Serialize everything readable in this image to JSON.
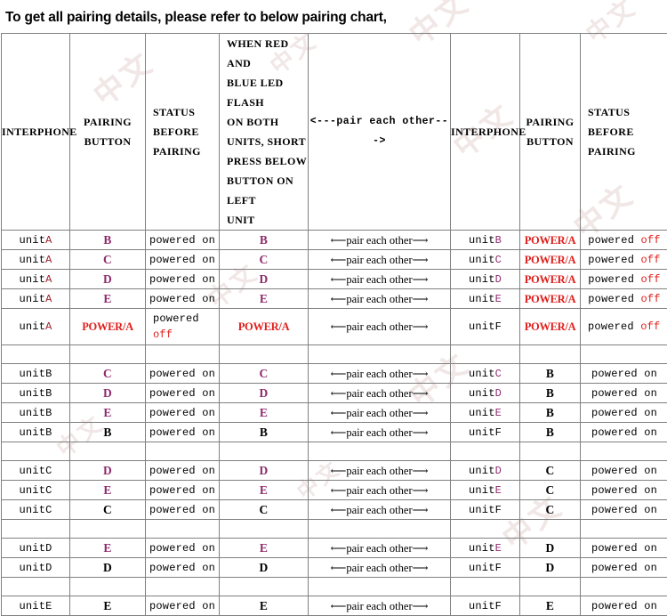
{
  "headline": "To get all pairing details, please refer to below pairing chart,",
  "colors": {
    "red": "#e01f1c",
    "dark_red": "#9e1d2b",
    "purple": "#8d2a6b",
    "black": "#000000",
    "border": "#808080"
  },
  "table": {
    "headers": [
      {
        "lines": [
          "INTERPHONE"
        ],
        "align": "center"
      },
      {
        "lines": [
          "PAIRING",
          "BUTTON"
        ],
        "align": "center"
      },
      {
        "lines": [
          "STATUS",
          "BEFORE",
          "PAIRING"
        ],
        "align": "left"
      },
      {
        "lines": [
          "WHEN RED AND",
          "BLUE LED FLASH",
          "ON BOTH",
          "UNITS, SHORT",
          "PRESS BELOW",
          "BUTTON ON LEFT",
          "UNIT"
        ],
        "align": "left"
      },
      {
        "lines": [
          "<---pair  each other--->"
        ],
        "align": "center"
      },
      {
        "lines": [
          "INTERPHONE"
        ],
        "align": "center"
      },
      {
        "lines": [
          "PAIRING",
          "BUTTON"
        ],
        "align": "center"
      },
      {
        "lines": [
          "STATUS",
          "BEFORE PAIRING"
        ],
        "align": "left"
      }
    ],
    "arrow_cell_text": "⟵pair each other⟶",
    "groups": [
      {
        "name": "group-unitA",
        "rows": [
          {
            "left_unit_base": "unit",
            "left_unit_suffix": "A",
            "left_unit_suffix_color": "darkred",
            "left_button": "B",
            "left_button_color": "purple",
            "left_status_line1": "powered on",
            "left_status_line2": "",
            "left_status_color2": "",
            "press_button": "B",
            "press_button_color": "purple",
            "right_unit_base": "unit",
            "right_unit_suffix": "B",
            "right_unit_suffix_color": "purple",
            "right_button": "POWER/A",
            "right_button_color": "red",
            "right_status_prefix": "powered ",
            "right_status_state": "off",
            "right_status_color": "red",
            "tall": false
          },
          {
            "left_unit_base": "unit",
            "left_unit_suffix": "A",
            "left_unit_suffix_color": "darkred",
            "left_button": "C",
            "left_button_color": "purple",
            "left_status_line1": "powered on",
            "left_status_line2": "",
            "left_status_color2": "",
            "press_button": "C",
            "press_button_color": "purple",
            "right_unit_base": "unit",
            "right_unit_suffix": "C",
            "right_unit_suffix_color": "purple",
            "right_button": "POWER/A",
            "right_button_color": "red",
            "right_status_prefix": "powered ",
            "right_status_state": "off",
            "right_status_color": "red",
            "tall": false
          },
          {
            "left_unit_base": "unit",
            "left_unit_suffix": "A",
            "left_unit_suffix_color": "darkred",
            "left_button": "D",
            "left_button_color": "purple",
            "left_status_line1": "powered on",
            "left_status_line2": "",
            "left_status_color2": "",
            "press_button": "D",
            "press_button_color": "purple",
            "right_unit_base": "unit",
            "right_unit_suffix": "D",
            "right_unit_suffix_color": "purple",
            "right_button": "POWER/A",
            "right_button_color": "red",
            "right_status_prefix": "powered ",
            "right_status_state": "off",
            "right_status_color": "red",
            "tall": false
          },
          {
            "left_unit_base": "unit",
            "left_unit_suffix": "A",
            "left_unit_suffix_color": "darkred",
            "left_button": "E",
            "left_button_color": "purple",
            "left_status_line1": "powered on",
            "left_status_line2": "",
            "left_status_color2": "",
            "press_button": "E",
            "press_button_color": "purple",
            "right_unit_base": "unit",
            "right_unit_suffix": "E",
            "right_unit_suffix_color": "purple",
            "right_button": "POWER/A",
            "right_button_color": "red",
            "right_status_prefix": "powered ",
            "right_status_state": "off",
            "right_status_color": "red",
            "tall": false
          },
          {
            "left_unit_base": "unit",
            "left_unit_suffix": "A",
            "left_unit_suffix_color": "darkred",
            "left_button": "POWER/A",
            "left_button_color": "red",
            "left_status_line1": "powered",
            "left_status_line2": "off",
            "left_status_color2": "red",
            "press_button": "POWER/A",
            "press_button_color": "red",
            "right_unit_base": "unit",
            "right_unit_suffix": "F",
            "right_unit_suffix_color": "black",
            "right_button": "POWER/A",
            "right_button_color": "red",
            "right_status_prefix": "powered ",
            "right_status_state": "off",
            "right_status_color": "red",
            "tall": true
          }
        ]
      },
      {
        "name": "group-unitB",
        "rows": [
          {
            "left_unit_base": "unit",
            "left_unit_suffix": "B",
            "left_unit_suffix_color": "black",
            "left_button": "C",
            "left_button_color": "purple",
            "left_status_line1": "powered on",
            "left_status_line2": "",
            "left_status_color2": "",
            "press_button": "C",
            "press_button_color": "purple",
            "right_unit_base": "unit",
            "right_unit_suffix": "C",
            "right_unit_suffix_color": "purple",
            "right_button": "B",
            "right_button_color": "black",
            "right_status_prefix": "powered ",
            "right_status_state": "on",
            "right_status_color": "black",
            "tall": false
          },
          {
            "left_unit_base": "unit",
            "left_unit_suffix": "B",
            "left_unit_suffix_color": "black",
            "left_button": "D",
            "left_button_color": "purple",
            "left_status_line1": "powered on",
            "left_status_line2": "",
            "left_status_color2": "",
            "press_button": "D",
            "press_button_color": "purple",
            "right_unit_base": "unit",
            "right_unit_suffix": "D",
            "right_unit_suffix_color": "purple",
            "right_button": "B",
            "right_button_color": "black",
            "right_status_prefix": "powered ",
            "right_status_state": "on",
            "right_status_color": "black",
            "tall": false
          },
          {
            "left_unit_base": "unit",
            "left_unit_suffix": "B",
            "left_unit_suffix_color": "black",
            "left_button": "E",
            "left_button_color": "purple",
            "left_status_line1": "powered on",
            "left_status_line2": "",
            "left_status_color2": "",
            "press_button": "E",
            "press_button_color": "purple",
            "right_unit_base": "unit",
            "right_unit_suffix": "E",
            "right_unit_suffix_color": "purple",
            "right_button": "B",
            "right_button_color": "black",
            "right_status_prefix": "powered ",
            "right_status_state": "on",
            "right_status_color": "black",
            "tall": false
          },
          {
            "left_unit_base": "unit",
            "left_unit_suffix": "B",
            "left_unit_suffix_color": "black",
            "left_button": "B",
            "left_button_color": "black",
            "left_status_line1": "powered on",
            "left_status_line2": "",
            "left_status_color2": "",
            "press_button": "B",
            "press_button_color": "black",
            "right_unit_base": "unit",
            "right_unit_suffix": "F",
            "right_unit_suffix_color": "black",
            "right_button": "B",
            "right_button_color": "black",
            "right_status_prefix": "powered ",
            "right_status_state": "on",
            "right_status_color": "black",
            "tall": false
          }
        ]
      },
      {
        "name": "group-unitC",
        "rows": [
          {
            "left_unit_base": "unit",
            "left_unit_suffix": "C",
            "left_unit_suffix_color": "black",
            "left_button": "D",
            "left_button_color": "purple",
            "left_status_line1": "powered on",
            "left_status_line2": "",
            "left_status_color2": "",
            "press_button": "D",
            "press_button_color": "purple",
            "right_unit_base": "unit",
            "right_unit_suffix": "D",
            "right_unit_suffix_color": "purple",
            "right_button": "C",
            "right_button_color": "black",
            "right_status_prefix": "powered ",
            "right_status_state": "on",
            "right_status_color": "black",
            "tall": false
          },
          {
            "left_unit_base": "unit",
            "left_unit_suffix": "C",
            "left_unit_suffix_color": "black",
            "left_button": "E",
            "left_button_color": "purple",
            "left_status_line1": "powered on",
            "left_status_line2": "",
            "left_status_color2": "",
            "press_button": "E",
            "press_button_color": "purple",
            "right_unit_base": "unit",
            "right_unit_suffix": "E",
            "right_unit_suffix_color": "purple",
            "right_button": "C",
            "right_button_color": "black",
            "right_status_prefix": "powered ",
            "right_status_state": "on",
            "right_status_color": "black",
            "tall": false
          },
          {
            "left_unit_base": "unit",
            "left_unit_suffix": "C",
            "left_unit_suffix_color": "black",
            "left_button": "C",
            "left_button_color": "black",
            "left_status_line1": "powered on",
            "left_status_line2": "",
            "left_status_color2": "",
            "press_button": "C",
            "press_button_color": "black",
            "right_unit_base": "unit",
            "right_unit_suffix": "F",
            "right_unit_suffix_color": "black",
            "right_button": "C",
            "right_button_color": "black",
            "right_status_prefix": "powered ",
            "right_status_state": "on",
            "right_status_color": "black",
            "tall": false
          }
        ]
      },
      {
        "name": "group-unitD",
        "rows": [
          {
            "left_unit_base": "unit",
            "left_unit_suffix": "D",
            "left_unit_suffix_color": "black",
            "left_button": "E",
            "left_button_color": "purple",
            "left_status_line1": "powered on",
            "left_status_line2": "",
            "left_status_color2": "",
            "press_button": "E",
            "press_button_color": "purple",
            "right_unit_base": "unit",
            "right_unit_suffix": "E",
            "right_unit_suffix_color": "purple",
            "right_button": "D",
            "right_button_color": "black",
            "right_status_prefix": "powered ",
            "right_status_state": "on",
            "right_status_color": "black",
            "tall": false
          },
          {
            "left_unit_base": "unit",
            "left_unit_suffix": "D",
            "left_unit_suffix_color": "black",
            "left_button": "D",
            "left_button_color": "black",
            "left_status_line1": "powered on",
            "left_status_line2": "",
            "left_status_color2": "",
            "press_button": "D",
            "press_button_color": "black",
            "right_unit_base": "unit",
            "right_unit_suffix": "F",
            "right_unit_suffix_color": "black",
            "right_button": "D",
            "right_button_color": "black",
            "right_status_prefix": "powered ",
            "right_status_state": "on",
            "right_status_color": "black",
            "tall": false
          }
        ]
      },
      {
        "name": "group-unitE",
        "rows": [
          {
            "left_unit_base": "unit",
            "left_unit_suffix": "E",
            "left_unit_suffix_color": "black",
            "left_button": "E",
            "left_button_color": "black",
            "left_status_line1": "powered on",
            "left_status_line2": "",
            "left_status_color2": "",
            "press_button": "E",
            "press_button_color": "black",
            "right_unit_base": "unit",
            "right_unit_suffix": "F",
            "right_unit_suffix_color": "black",
            "right_button": "E",
            "right_button_color": "black",
            "right_status_prefix": "powered ",
            "right_status_state": "on",
            "right_status_color": "black",
            "tall": false
          }
        ]
      }
    ]
  },
  "watermarks": [
    "中文",
    "中文",
    "中文",
    "中文",
    "中文",
    "中文",
    "中文",
    "中文",
    "中文",
    "中文",
    "中文"
  ]
}
